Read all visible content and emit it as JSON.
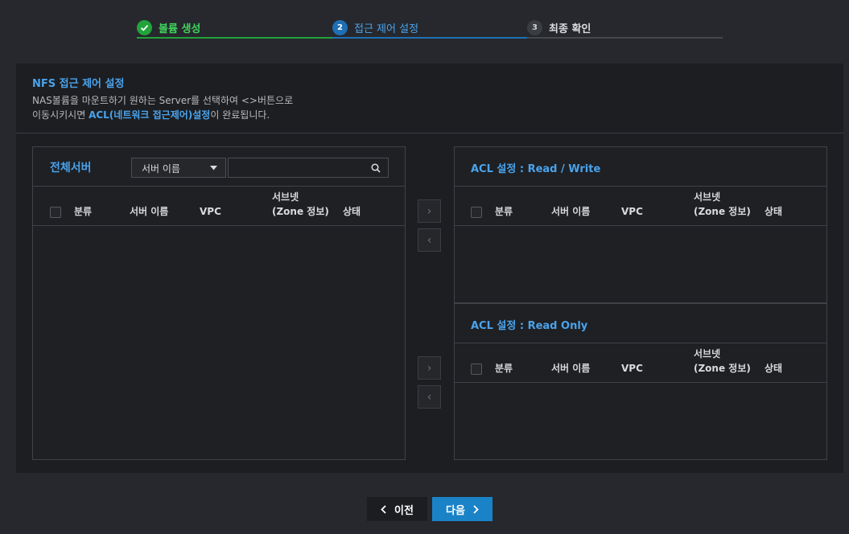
{
  "stepper": {
    "steps": [
      {
        "label": "볼륨 생성",
        "number": "✓",
        "state": "done"
      },
      {
        "label": "접근 제어 설정",
        "number": "2",
        "state": "active"
      },
      {
        "label": "최종 확인",
        "number": "3",
        "state": "pending"
      }
    ]
  },
  "section": {
    "title": "NFS 접근 제어 설정",
    "desc_line1": "NAS볼륨을 마운트하기 원하는 Server를 선택하여 <>버튼으로",
    "desc_line2_pre": "이동시키시면 ",
    "desc_line2_bold": "ACL(네트워크 접근제어)설정",
    "desc_line2_post": "이 완료됩니다."
  },
  "all_servers": {
    "title": "전체서버",
    "select_value": "서버 이름",
    "search_placeholder": ""
  },
  "columns": {
    "category": "분류",
    "server_name": "서버 이름",
    "vpc": "VPC",
    "subnet_line1": "서브넷",
    "subnet_line2": "(Zone 정보)",
    "status": "상태"
  },
  "acl_rw": {
    "title": "ACL 설정 : Read / Write"
  },
  "acl_ro": {
    "title": "ACL 설정 : Read Only"
  },
  "move_buttons": {
    "right": "›",
    "left": "‹"
  },
  "footer": {
    "prev_label": "이전",
    "next_label": "다음"
  },
  "colors": {
    "accent": "#4aa3ec",
    "done": "#22a33b",
    "active": "#1f6fb5",
    "next_button": "#1a83c7",
    "prev_button": "#1b1d21"
  }
}
